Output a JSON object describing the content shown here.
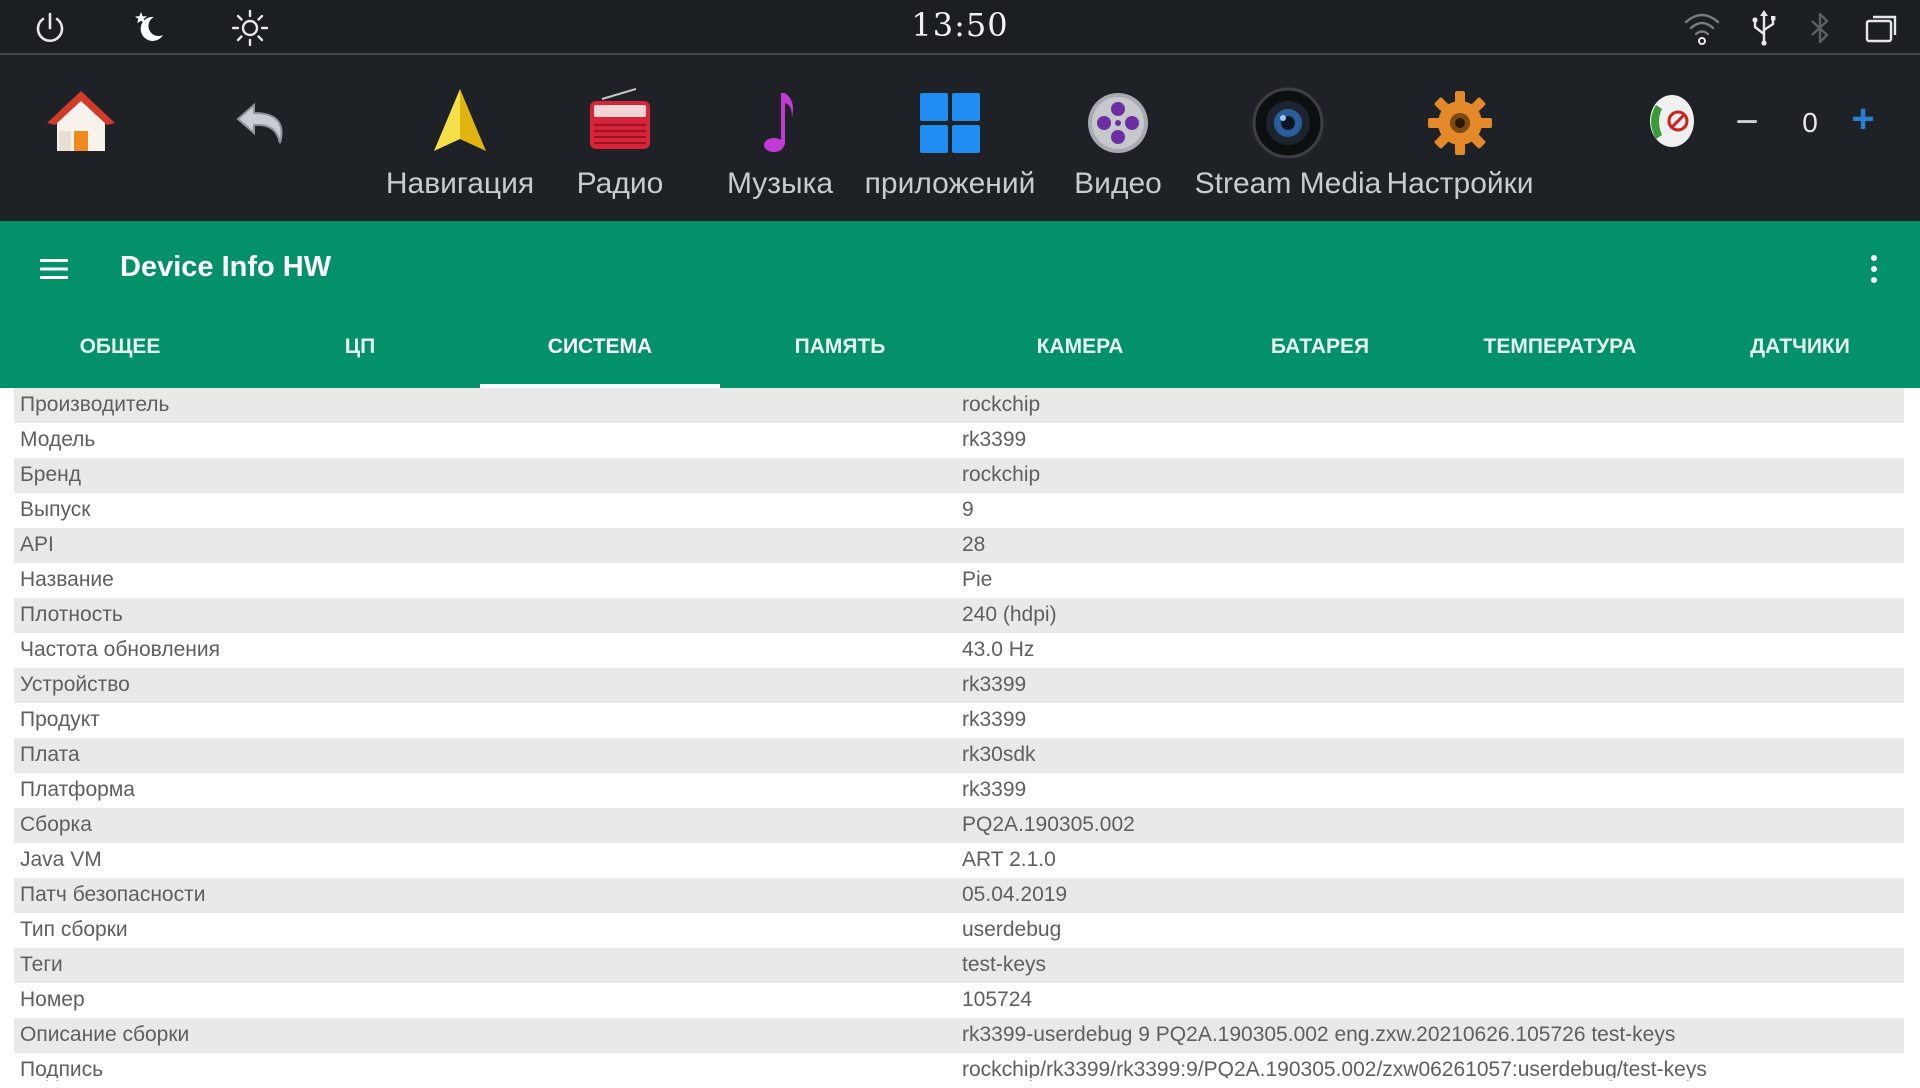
{
  "status_bar": {
    "time": "13:50",
    "icons": [
      "power-icon",
      "night-mode-icon",
      "brightness-icon",
      "wifi-icon",
      "usb-icon",
      "bluetooth-icon",
      "recent-apps-icon"
    ]
  },
  "launcher": {
    "apps": [
      {
        "label": "",
        "icon": "home-icon"
      },
      {
        "label": "",
        "icon": "back-icon"
      },
      {
        "label": "Навигация",
        "icon": "navigation-icon"
      },
      {
        "label": "Радио",
        "icon": "radio-icon"
      },
      {
        "label": "Музыка",
        "icon": "music-icon"
      },
      {
        "label": "приложений",
        "icon": "apps-grid-icon"
      },
      {
        "label": "Видео",
        "icon": "video-icon"
      },
      {
        "label": "Stream Media",
        "icon": "stream-media-icon"
      },
      {
        "label": "Настройки",
        "icon": "settings-icon"
      }
    ],
    "volume": {
      "value": "0",
      "minus": "−",
      "plus": "+",
      "icon": "volume-muted-icon"
    }
  },
  "app": {
    "title": "Device Info HW",
    "tabs": [
      "ОБЩЕЕ",
      "ЦП",
      "СИСТЕМА",
      "ПАМЯТЬ",
      "КАМЕРА",
      "БАТАРЕЯ",
      "ТЕМПЕРАТУРА",
      "ДАТЧИКИ"
    ],
    "active_tab": "СИСТЕМА"
  },
  "table": {
    "rows": [
      {
        "key": "Производитель",
        "value": "rockchip"
      },
      {
        "key": "Модель",
        "value": "rk3399"
      },
      {
        "key": "Бренд",
        "value": "rockchip"
      },
      {
        "key": "Выпуск",
        "value": "9"
      },
      {
        "key": "API",
        "value": "28"
      },
      {
        "key": "Название",
        "value": "Pie"
      },
      {
        "key": "Плотность",
        "value": "240 (hdpi)"
      },
      {
        "key": "Частота обновления",
        "value": "43.0 Hz"
      },
      {
        "key": "Устройство",
        "value": "rk3399"
      },
      {
        "key": "Продукт",
        "value": "rk3399"
      },
      {
        "key": "Плата",
        "value": "rk30sdk"
      },
      {
        "key": "Платформа",
        "value": "rk3399"
      },
      {
        "key": "Сборка",
        "value": "PQ2A.190305.002"
      },
      {
        "key": "Java VM",
        "value": "ART 2.1.0"
      },
      {
        "key": "Патч безопасности",
        "value": "05.04.2019"
      },
      {
        "key": "Тип сборки",
        "value": "userdebug"
      },
      {
        "key": "Теги",
        "value": "test-keys"
      },
      {
        "key": "Номер",
        "value": "105724"
      },
      {
        "key": "Описание сборки",
        "value": "rk3399-userdebug 9 PQ2A.190305.002 eng.zxw.20210626.105726 test-keys"
      },
      {
        "key": "Подпись",
        "value": "rockchip/rk3399/rk3399:9/PQ2A.190305.002/zxw06261057:userdebug/test-keys"
      }
    ]
  },
  "colors": {
    "status_bg": "#1c1f22",
    "launcher_bg": "#1e2226",
    "accent": "#039169",
    "row_alt": "#e9e9e9",
    "plus_blue": "#2a7fd4"
  }
}
